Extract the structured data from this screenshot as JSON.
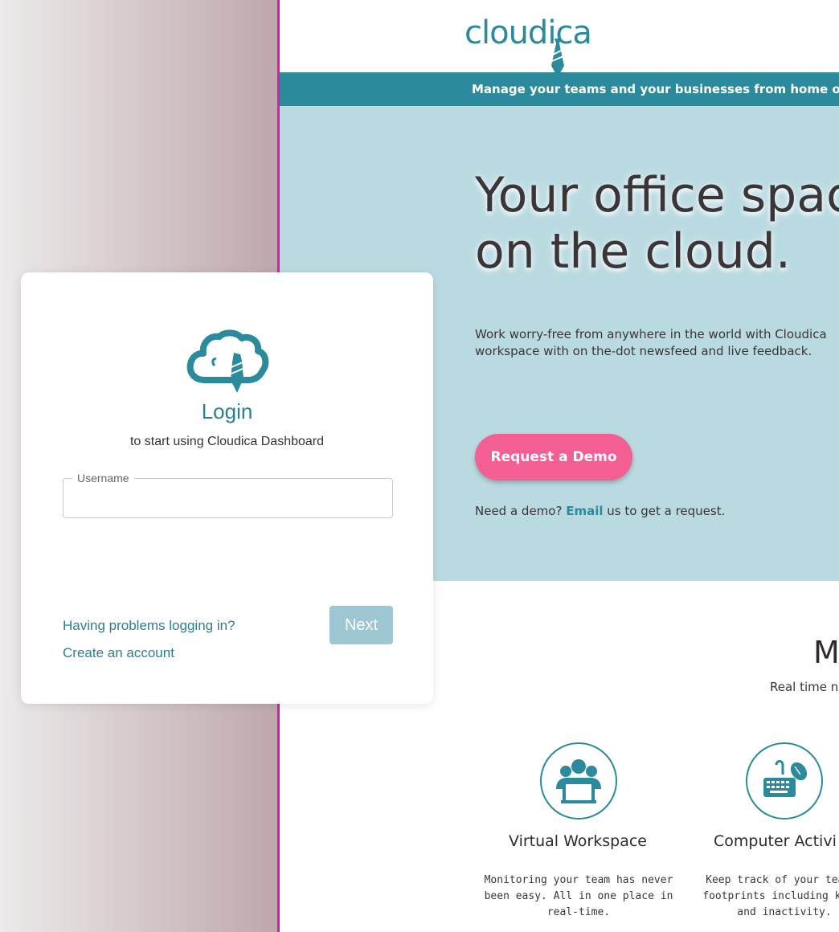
{
  "site": {
    "brand": "cloudica",
    "tagline": "Manage your teams and your businesses from home or an",
    "hero": {
      "title_line1": "Your office spac",
      "title_line2": "on the cloud.",
      "body_line1": "Work worry-free from anywhere in the world with Cloudica",
      "body_line2": "workspace with on the-dot newsfeed and live feedback.",
      "demo_button": "Request a Demo",
      "demo_note_prefix": "Need a demo?",
      "demo_note_link": "Email",
      "demo_note_suffix": "us to get a request."
    },
    "section": {
      "heading": "MC",
      "subheading": "Real time n"
    },
    "features": [
      {
        "icon": "team-icon",
        "title": "Virtual Workspace",
        "desc_line1": "Monitoring your team has never",
        "desc_line2": "been easy. All in one place in",
        "desc_line3": "real-time."
      },
      {
        "icon": "keyboard-mouse-icon",
        "title": "Computer Activi",
        "desc_line1": "Keep track of your team's",
        "desc_line2": "footprints including keyst",
        "desc_line3": "and inactivity."
      }
    ]
  },
  "login": {
    "title": "Login",
    "subtitle": "to start using Cloudica Dashboard",
    "username_label": "Username",
    "username_value": "",
    "problems_link": "Having problems logging in?",
    "create_account_link": "Create an account",
    "next_button": "Next"
  },
  "colors": {
    "brand_teal": "#2b8a9c",
    "hero_bg": "#badae1",
    "demo_pink": "#f35e93",
    "divider_magenta": "#d61fa8",
    "next_disabled": "#9ec6d3"
  }
}
